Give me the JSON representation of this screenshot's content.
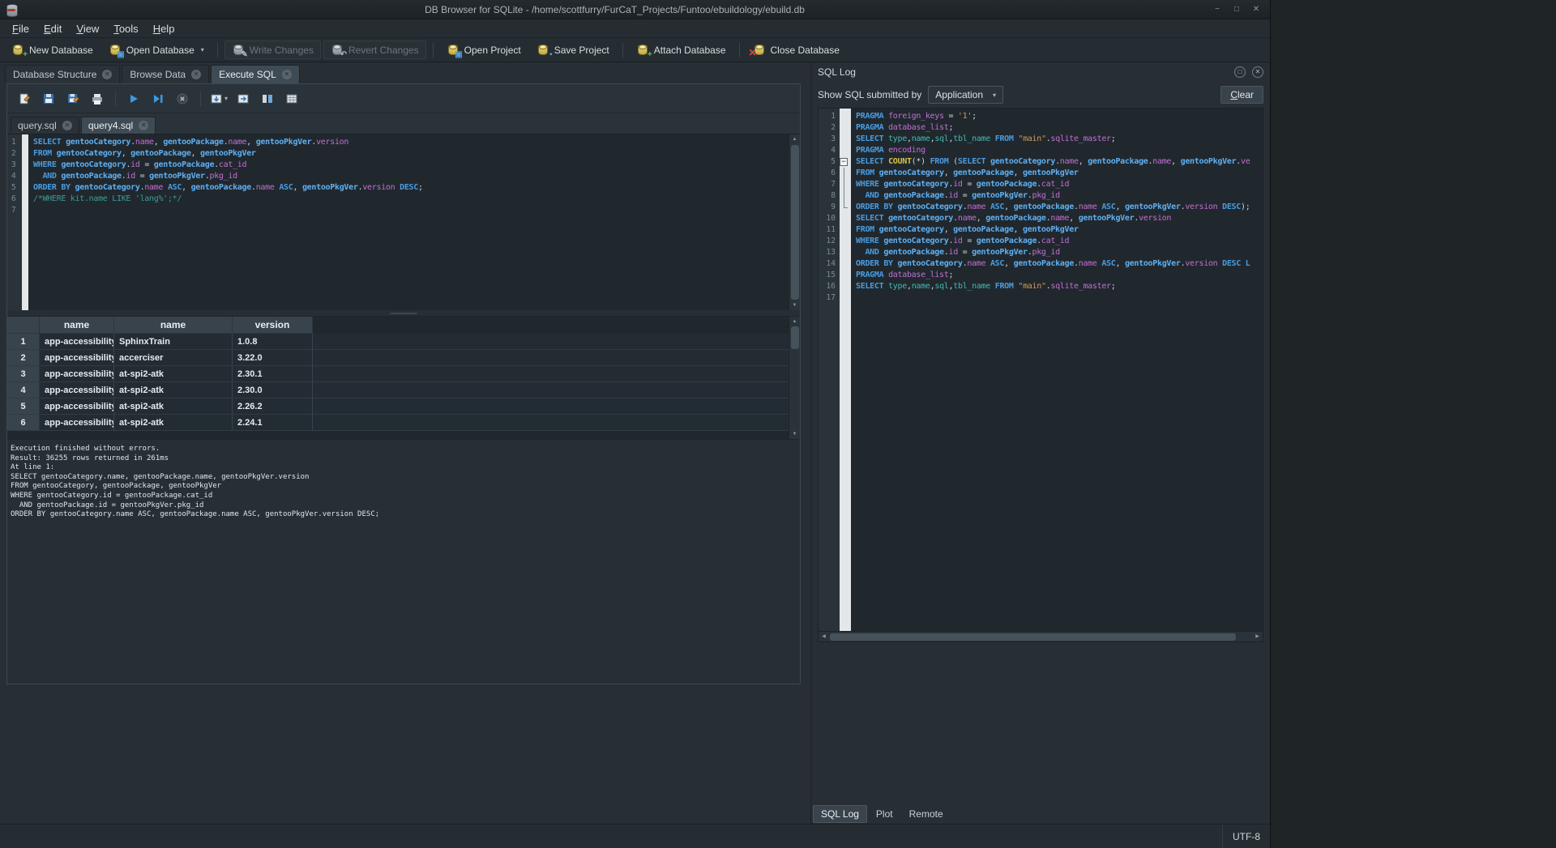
{
  "window": {
    "title": "DB Browser for SQLite - /home/scottfurry/FurCaT_Projects/Funtoo/ebuildology/ebuild.db"
  },
  "icons": {
    "minimize": "−",
    "maximize": "□",
    "close": "✕",
    "dropdown": "▾",
    "tab_close": "✕",
    "up": "▲",
    "down": "▼",
    "left": "◀",
    "right": "▶",
    "fold_collapse": "−",
    "dock_float": "□",
    "dock_close": "✕",
    "plus": "+",
    "pencil": "✎",
    "undo": "↶",
    "red_x": "✕",
    "folder": "▣",
    "floppy": "▪"
  },
  "menu": {
    "items": [
      "File",
      "Edit",
      "View",
      "Tools",
      "Help"
    ]
  },
  "toolbar": {
    "buttons": [
      {
        "label": "New Database",
        "enabled": true
      },
      {
        "label": "Open Database",
        "enabled": true,
        "dropdown": true
      },
      {
        "label": "Write Changes",
        "enabled": false
      },
      {
        "label": "Revert Changes",
        "enabled": false
      },
      {
        "label": "Open Project",
        "enabled": true
      },
      {
        "label": "Save Project",
        "enabled": true
      },
      {
        "label": "Attach Database",
        "enabled": true
      },
      {
        "label": "Close Database",
        "enabled": true
      }
    ]
  },
  "main_tabs": [
    {
      "label": "Database Structure",
      "active": false
    },
    {
      "label": "Browse Data",
      "active": false
    },
    {
      "label": "Execute SQL",
      "active": true
    }
  ],
  "sql_tabs": [
    {
      "label": "query.sql",
      "active": false
    },
    {
      "label": "query4.sql",
      "active": true
    }
  ],
  "editor": {
    "lines": [
      {
        "tokens": [
          [
            "kw",
            "SELECT"
          ],
          [
            "pl",
            " "
          ],
          [
            "tbl",
            "gentooCategory"
          ],
          [
            "pl",
            "."
          ],
          [
            "fld",
            "name"
          ],
          [
            "pl",
            ", "
          ],
          [
            "tbl",
            "gentooPackage"
          ],
          [
            "pl",
            "."
          ],
          [
            "fld",
            "name"
          ],
          [
            "pl",
            ", "
          ],
          [
            "tbl",
            "gentooPkgVer"
          ],
          [
            "pl",
            "."
          ],
          [
            "fld",
            "version"
          ]
        ]
      },
      {
        "tokens": [
          [
            "kw",
            "FROM"
          ],
          [
            "pl",
            " "
          ],
          [
            "tbl",
            "gentooCategory"
          ],
          [
            "pl",
            ", "
          ],
          [
            "tbl",
            "gentooPackage"
          ],
          [
            "pl",
            ", "
          ],
          [
            "tbl",
            "gentooPkgVer"
          ]
        ]
      },
      {
        "tokens": [
          [
            "kw",
            "WHERE"
          ],
          [
            "pl",
            " "
          ],
          [
            "tbl",
            "gentooCategory"
          ],
          [
            "pl",
            "."
          ],
          [
            "fld",
            "id"
          ],
          [
            "pl",
            " = "
          ],
          [
            "tbl",
            "gentooPackage"
          ],
          [
            "pl",
            "."
          ],
          [
            "fld",
            "cat_id"
          ]
        ]
      },
      {
        "tokens": [
          [
            "pl",
            "  "
          ],
          [
            "kw",
            "AND"
          ],
          [
            "pl",
            " "
          ],
          [
            "tbl",
            "gentooPackage"
          ],
          [
            "pl",
            "."
          ],
          [
            "fld",
            "id"
          ],
          [
            "pl",
            " = "
          ],
          [
            "tbl",
            "gentooPkgVer"
          ],
          [
            "pl",
            "."
          ],
          [
            "fld",
            "pkg_id"
          ]
        ]
      },
      {
        "tokens": [
          [
            "kw",
            "ORDER BY"
          ],
          [
            "pl",
            " "
          ],
          [
            "tbl",
            "gentooCategory"
          ],
          [
            "pl",
            "."
          ],
          [
            "fld",
            "name"
          ],
          [
            "pl",
            " "
          ],
          [
            "kw",
            "ASC"
          ],
          [
            "pl",
            ", "
          ],
          [
            "tbl",
            "gentooPackage"
          ],
          [
            "pl",
            "."
          ],
          [
            "fld",
            "name"
          ],
          [
            "pl",
            " "
          ],
          [
            "kw",
            "ASC"
          ],
          [
            "pl",
            ", "
          ],
          [
            "tbl",
            "gentooPkgVer"
          ],
          [
            "pl",
            "."
          ],
          [
            "fld",
            "version"
          ],
          [
            "pl",
            " "
          ],
          [
            "kw",
            "DESC"
          ],
          [
            "pl",
            ";"
          ]
        ]
      },
      {
        "tokens": [
          [
            "cmt",
            "/*WHERE kit.name LIKE 'lang%';*/"
          ]
        ]
      },
      {
        "tokens": []
      }
    ]
  },
  "results": {
    "columns": [
      "name",
      "name",
      "version"
    ],
    "rows": [
      [
        "app-accessibility",
        "SphinxTrain",
        "1.0.8"
      ],
      [
        "app-accessibility",
        "accerciser",
        "3.22.0"
      ],
      [
        "app-accessibility",
        "at-spi2-atk",
        "2.30.1"
      ],
      [
        "app-accessibility",
        "at-spi2-atk",
        "2.30.0"
      ],
      [
        "app-accessibility",
        "at-spi2-atk",
        "2.26.2"
      ],
      [
        "app-accessibility",
        "at-spi2-atk",
        "2.24.1"
      ]
    ]
  },
  "messages": [
    "Execution finished without errors.",
    "Result: 36255 rows returned in 261ms",
    "At line 1:",
    "SELECT gentooCategory.name, gentooPackage.name, gentooPkgVer.version",
    "FROM gentooCategory, gentooPackage, gentooPkgVer",
    "WHERE gentooCategory.id = gentooPackage.cat_id",
    "  AND gentooPackage.id = gentooPkgVer.pkg_id",
    "ORDER BY gentooCategory.name ASC, gentooPackage.name ASC, gentooPkgVer.version DESC;"
  ],
  "sql_log": {
    "title": "SQL Log",
    "show_label": "Show SQL submitted by",
    "filter_value": "Application",
    "clear_label": "Clear",
    "lines": [
      {
        "tokens": [
          [
            "kw",
            "PRAGMA"
          ],
          [
            "pl",
            " "
          ],
          [
            "fld",
            "foreign_keys"
          ],
          [
            "pl",
            " = "
          ],
          [
            "str",
            "'1'"
          ],
          [
            "pl",
            ";"
          ]
        ]
      },
      {
        "tokens": [
          [
            "kw",
            "PRAGMA"
          ],
          [
            "pl",
            " "
          ],
          [
            "fld",
            "database_list"
          ],
          [
            "pl",
            ";"
          ]
        ]
      },
      {
        "tokens": [
          [
            "kw",
            "SELECT"
          ],
          [
            "pl",
            " "
          ],
          [
            "idc",
            "type"
          ],
          [
            "pl",
            ","
          ],
          [
            "idc",
            "name"
          ],
          [
            "pl",
            ","
          ],
          [
            "idc",
            "sql"
          ],
          [
            "pl",
            ","
          ],
          [
            "idc",
            "tbl_name"
          ],
          [
            "pl",
            " "
          ],
          [
            "kw",
            "FROM"
          ],
          [
            "pl",
            " "
          ],
          [
            "str",
            "\"main\""
          ],
          [
            "pl",
            "."
          ],
          [
            "fld",
            "sqlite_master"
          ],
          [
            "pl",
            ";"
          ]
        ]
      },
      {
        "tokens": [
          [
            "kw",
            "PRAGMA"
          ],
          [
            "pl",
            " "
          ],
          [
            "fld",
            "encoding"
          ]
        ]
      },
      {
        "fold": "start",
        "tokens": [
          [
            "kw",
            "SELECT"
          ],
          [
            "pl",
            " "
          ],
          [
            "fn",
            "COUNT"
          ],
          [
            "pl",
            "(*) "
          ],
          [
            "kw",
            "FROM"
          ],
          [
            "pl",
            " ("
          ],
          [
            "kw",
            "SELECT"
          ],
          [
            "pl",
            " "
          ],
          [
            "tbl",
            "gentooCategory"
          ],
          [
            "pl",
            "."
          ],
          [
            "fld",
            "name"
          ],
          [
            "pl",
            ", "
          ],
          [
            "tbl",
            "gentooPackage"
          ],
          [
            "pl",
            "."
          ],
          [
            "fld",
            "name"
          ],
          [
            "pl",
            ", "
          ],
          [
            "tbl",
            "gentooPkgVer"
          ],
          [
            "pl",
            "."
          ],
          [
            "fld",
            "ve"
          ]
        ]
      },
      {
        "fold": "mid",
        "tokens": [
          [
            "kw",
            "FROM"
          ],
          [
            "pl",
            " "
          ],
          [
            "tbl",
            "gentooCategory"
          ],
          [
            "pl",
            ", "
          ],
          [
            "tbl",
            "gentooPackage"
          ],
          [
            "pl",
            ", "
          ],
          [
            "tbl",
            "gentooPkgVer"
          ]
        ]
      },
      {
        "fold": "mid",
        "tokens": [
          [
            "kw",
            "WHERE"
          ],
          [
            "pl",
            " "
          ],
          [
            "tbl",
            "gentooCategory"
          ],
          [
            "pl",
            "."
          ],
          [
            "fld",
            "id"
          ],
          [
            "pl",
            " = "
          ],
          [
            "tbl",
            "gentooPackage"
          ],
          [
            "pl",
            "."
          ],
          [
            "fld",
            "cat_id"
          ]
        ]
      },
      {
        "fold": "mid",
        "tokens": [
          [
            "pl",
            "  "
          ],
          [
            "kw",
            "AND"
          ],
          [
            "pl",
            " "
          ],
          [
            "tbl",
            "gentooPackage"
          ],
          [
            "pl",
            "."
          ],
          [
            "fld",
            "id"
          ],
          [
            "pl",
            " = "
          ],
          [
            "tbl",
            "gentooPkgVer"
          ],
          [
            "pl",
            "."
          ],
          [
            "fld",
            "pkg_id"
          ]
        ]
      },
      {
        "fold": "end",
        "tokens": [
          [
            "kw",
            "ORDER BY"
          ],
          [
            "pl",
            " "
          ],
          [
            "tbl",
            "gentooCategory"
          ],
          [
            "pl",
            "."
          ],
          [
            "fld",
            "name"
          ],
          [
            "pl",
            " "
          ],
          [
            "kw",
            "ASC"
          ],
          [
            "pl",
            ", "
          ],
          [
            "tbl",
            "gentooPackage"
          ],
          [
            "pl",
            "."
          ],
          [
            "fld",
            "name"
          ],
          [
            "pl",
            " "
          ],
          [
            "kw",
            "ASC"
          ],
          [
            "pl",
            ", "
          ],
          [
            "tbl",
            "gentooPkgVer"
          ],
          [
            "pl",
            "."
          ],
          [
            "fld",
            "version"
          ],
          [
            "pl",
            " "
          ],
          [
            "kw",
            "DESC"
          ],
          [
            "pl",
            ");"
          ]
        ]
      },
      {
        "tokens": [
          [
            "kw",
            "SELECT"
          ],
          [
            "pl",
            " "
          ],
          [
            "tbl",
            "gentooCategory"
          ],
          [
            "pl",
            "."
          ],
          [
            "fld",
            "name"
          ],
          [
            "pl",
            ", "
          ],
          [
            "tbl",
            "gentooPackage"
          ],
          [
            "pl",
            "."
          ],
          [
            "fld",
            "name"
          ],
          [
            "pl",
            ", "
          ],
          [
            "tbl",
            "gentooPkgVer"
          ],
          [
            "pl",
            "."
          ],
          [
            "fld",
            "version"
          ]
        ]
      },
      {
        "tokens": [
          [
            "kw",
            "FROM"
          ],
          [
            "pl",
            " "
          ],
          [
            "tbl",
            "gentooCategory"
          ],
          [
            "pl",
            ", "
          ],
          [
            "tbl",
            "gentooPackage"
          ],
          [
            "pl",
            ", "
          ],
          [
            "tbl",
            "gentooPkgVer"
          ]
        ]
      },
      {
        "tokens": [
          [
            "kw",
            "WHERE"
          ],
          [
            "pl",
            " "
          ],
          [
            "tbl",
            "gentooCategory"
          ],
          [
            "pl",
            "."
          ],
          [
            "fld",
            "id"
          ],
          [
            "pl",
            " = "
          ],
          [
            "tbl",
            "gentooPackage"
          ],
          [
            "pl",
            "."
          ],
          [
            "fld",
            "cat_id"
          ]
        ]
      },
      {
        "tokens": [
          [
            "pl",
            "  "
          ],
          [
            "kw",
            "AND"
          ],
          [
            "pl",
            " "
          ],
          [
            "tbl",
            "gentooPackage"
          ],
          [
            "pl",
            "."
          ],
          [
            "fld",
            "id"
          ],
          [
            "pl",
            " = "
          ],
          [
            "tbl",
            "gentooPkgVer"
          ],
          [
            "pl",
            "."
          ],
          [
            "fld",
            "pkg_id"
          ]
        ]
      },
      {
        "tokens": [
          [
            "kw",
            "ORDER BY"
          ],
          [
            "pl",
            " "
          ],
          [
            "tbl",
            "gentooCategory"
          ],
          [
            "pl",
            "."
          ],
          [
            "fld",
            "name"
          ],
          [
            "pl",
            " "
          ],
          [
            "kw",
            "ASC"
          ],
          [
            "pl",
            ", "
          ],
          [
            "tbl",
            "gentooPackage"
          ],
          [
            "pl",
            "."
          ],
          [
            "fld",
            "name"
          ],
          [
            "pl",
            " "
          ],
          [
            "kw",
            "ASC"
          ],
          [
            "pl",
            ", "
          ],
          [
            "tbl",
            "gentooPkgVer"
          ],
          [
            "pl",
            "."
          ],
          [
            "fld",
            "version"
          ],
          [
            "pl",
            " "
          ],
          [
            "kw",
            "DESC"
          ],
          [
            "pl",
            " "
          ],
          [
            "kw",
            "L"
          ]
        ]
      },
      {
        "tokens": [
          [
            "kw",
            "PRAGMA"
          ],
          [
            "pl",
            " "
          ],
          [
            "fld",
            "database_list"
          ],
          [
            "pl",
            ";"
          ]
        ]
      },
      {
        "tokens": [
          [
            "kw",
            "SELECT"
          ],
          [
            "pl",
            " "
          ],
          [
            "idc",
            "type"
          ],
          [
            "pl",
            ","
          ],
          [
            "idc",
            "name"
          ],
          [
            "pl",
            ","
          ],
          [
            "idc",
            "sql"
          ],
          [
            "pl",
            ","
          ],
          [
            "idc",
            "tbl_name"
          ],
          [
            "pl",
            " "
          ],
          [
            "kw",
            "FROM"
          ],
          [
            "pl",
            " "
          ],
          [
            "str",
            "\"main\""
          ],
          [
            "pl",
            "."
          ],
          [
            "fld",
            "sqlite_master"
          ],
          [
            "pl",
            ";"
          ]
        ]
      },
      {
        "tokens": []
      }
    ]
  },
  "dock_tabs": [
    "SQL Log",
    "Plot",
    "Remote"
  ],
  "status": {
    "encoding": "UTF-8"
  },
  "theme": {
    "accent": "#3daee9",
    "keyword": "#4a9ce0",
    "table_name": "#5fb0f2",
    "field": "#c46ed2",
    "string": "#d29a55",
    "comment": "#3f9b94",
    "function": "#d4c24a",
    "identifier": "#45b8ae",
    "window_bg": "#272f35",
    "editor_bg": "#20282e",
    "header_bg": "#39434b"
  }
}
